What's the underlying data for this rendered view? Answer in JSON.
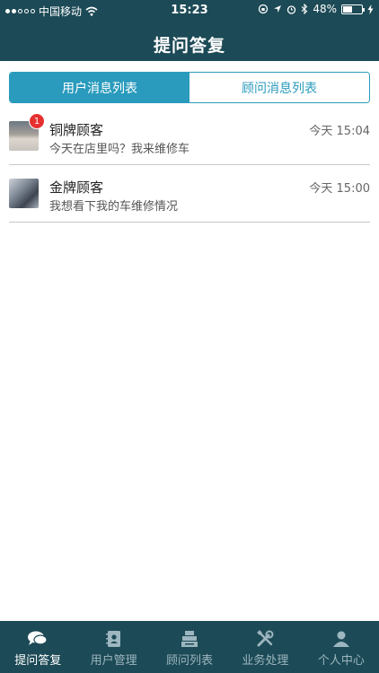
{
  "status_bar": {
    "carrier": "中国移动",
    "time": "15:23",
    "battery": "48%",
    "battery_level": 0.48
  },
  "header": {
    "title": "提问答复"
  },
  "segments": [
    {
      "label": "用户消息列表",
      "active": true
    },
    {
      "label": "顾问消息列表",
      "active": false
    }
  ],
  "messages": [
    {
      "name": "铜牌顾客",
      "time": "今天 15:04",
      "text": "今天在店里吗？我来维修车",
      "badge": "1"
    },
    {
      "name": "金牌顾客",
      "time": "今天 15:00",
      "text": "我想看下我的车维修情况"
    }
  ],
  "tabbar": [
    {
      "label": "提问答复",
      "icon": "chat-bubble-icon",
      "active": true
    },
    {
      "label": "用户管理",
      "icon": "contacts-book-icon",
      "active": false
    },
    {
      "label": "顾问列表",
      "icon": "register-icon",
      "active": false
    },
    {
      "label": "业务处理",
      "icon": "tools-icon",
      "active": false
    },
    {
      "label": "个人中心",
      "icon": "person-icon",
      "active": false
    }
  ],
  "colors": {
    "header_bg": "#1c4a56",
    "accent": "#2a9bbd",
    "badge": "#e63030"
  }
}
